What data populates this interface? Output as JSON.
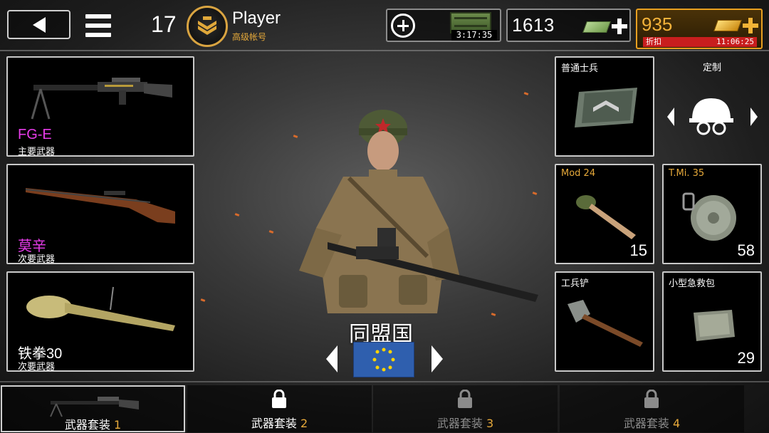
{
  "header": {
    "level": "17",
    "player_name": "Player",
    "account_type": "高级帐号"
  },
  "resources": {
    "crate_timer": "3:17:35",
    "cash": "1613",
    "gold": "935",
    "sale_label": "折扣",
    "sale_timer": "11:06:25"
  },
  "weapons": {
    "primary": {
      "name": "FG-E",
      "type": "主要武器"
    },
    "secondary": {
      "name": "莫辛",
      "type": "次要武器"
    },
    "third": {
      "name": "铁拳30",
      "type": "次要武器"
    }
  },
  "soldier": {
    "faction": "同盟国"
  },
  "equipment": {
    "rank": {
      "title": "普通士兵"
    },
    "customize": {
      "title": "定制"
    },
    "grenade": {
      "title": "Mod 24",
      "count": "15"
    },
    "mine": {
      "title": "T.Mi. 35",
      "count": "58"
    },
    "shovel": {
      "title": "工兵铲"
    },
    "medkit": {
      "title": "小型急救包",
      "count": "29"
    }
  },
  "loadout_tabs": [
    {
      "label": "武器套装",
      "num": "1",
      "locked": false
    },
    {
      "label": "武器套装",
      "num": "2",
      "locked": true
    },
    {
      "label": "武器套装",
      "num": "3",
      "locked": true
    },
    {
      "label": "武器套装",
      "num": "4",
      "locked": true
    }
  ],
  "colors": {
    "accent_orange": "#e6a93a",
    "weapon_name_magenta": "#e73cea",
    "gold": "#f3b23a",
    "sale_red": "#c81e1e",
    "frame_border": "#c9c9c9"
  },
  "icons": {
    "back": "back-arrow-icon",
    "menu": "hamburger-menu-icon",
    "rank": "sergeant-chevron-icon",
    "add": "plus-circle-icon",
    "crate": "supply-crate-icon",
    "cash": "cash-bill-icon",
    "gold": "gold-bar-icon",
    "lock": "padlock-icon",
    "helmet": "helmet-icon"
  }
}
